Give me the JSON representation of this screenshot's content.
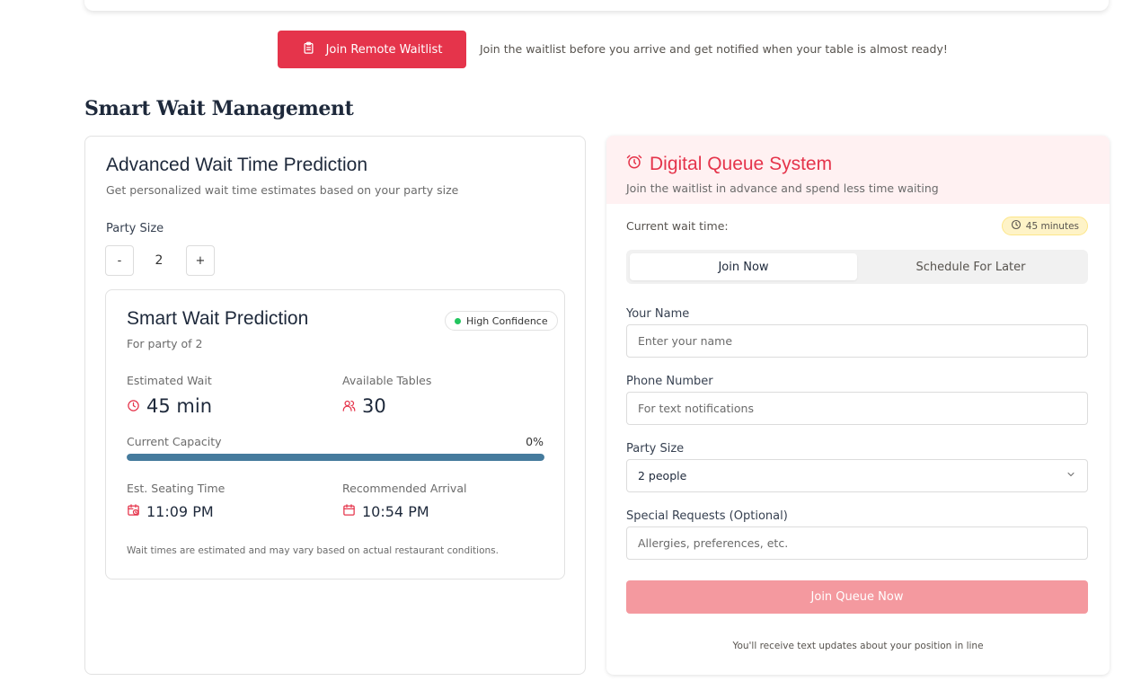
{
  "remote": {
    "button_label": "Join Remote Waitlist",
    "description": "Join the waitlist before you arrive and get notified when your table is almost ready!"
  },
  "section": {
    "title": "Smart Wait Management"
  },
  "prediction": {
    "title": "Advanced Wait Time Prediction",
    "subtitle": "Get personalized wait time estimates based on your party size",
    "party_size_label": "Party Size",
    "minus_label": "-",
    "plus_label": "+",
    "party_size_value": "2",
    "card": {
      "title": "Smart Wait Prediction",
      "subtitle": "For party of 2",
      "confidence_badge": "High Confidence",
      "estimated_wait_label": "Estimated Wait",
      "estimated_wait_value": "45 min",
      "available_tables_label": "Available Tables",
      "available_tables_value": "30",
      "capacity_label": "Current Capacity",
      "capacity_percent_label": "0%",
      "capacity_fill": 1.0,
      "seating_label": "Est. Seating Time",
      "seating_value": "11:09 PM",
      "arrival_label": "Recommended Arrival",
      "arrival_value": "10:54 PM",
      "disclaimer": "Wait times are estimated and may vary based on actual restaurant conditions."
    }
  },
  "queue": {
    "title": "Digital Queue System",
    "subtitle": "Join the waitlist in advance and spend less time waiting",
    "wait_label": "Current wait time:",
    "wait_badge": "45 minutes",
    "tabs": [
      {
        "label": "Join Now",
        "active": true
      },
      {
        "label": "Schedule For Later",
        "active": false
      }
    ],
    "fields": {
      "name_label": "Your Name",
      "name_placeholder": "Enter your name",
      "phone_label": "Phone Number",
      "phone_placeholder": "For text notifications",
      "party_label": "Party Size",
      "party_value": "2 people",
      "requests_label": "Special Requests (Optional)",
      "requests_placeholder": "Allergies, preferences, etc."
    },
    "submit_label": "Join Queue Now",
    "footnote": "You'll receive text updates about your position in line"
  },
  "colors": {
    "accent": "#e5344b",
    "accent_light": "#f4999f",
    "progress": "#457b9d",
    "confidence_dot": "#22c55e",
    "header_tint": "#fff1f2"
  },
  "icons": {
    "remote_button": "clipboard-icon",
    "estimated_wait": "clock-icon",
    "available_tables": "users-icon",
    "seating": "calendar-clock-icon",
    "arrival": "calendar-icon",
    "queue_title": "alarm-clock-icon",
    "wait_badge": "clock-icon",
    "party_select": "chevron-down-icon"
  }
}
